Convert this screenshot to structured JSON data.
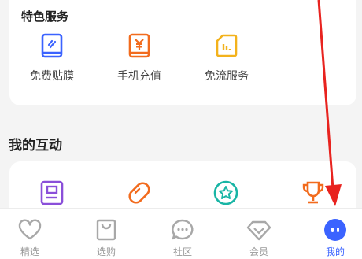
{
  "special": {
    "title": "特色服务",
    "items": [
      {
        "label": "免费贴膜",
        "icon": "phone-film-icon"
      },
      {
        "label": "手机充值",
        "icon": "yuan-recharge-icon"
      },
      {
        "label": "免流服务",
        "icon": "sim-card-icon"
      }
    ]
  },
  "interaction": {
    "title": "我的互动",
    "icons": [
      "portrait-icon",
      "capsule-icon",
      "star-badge-icon",
      "trophy-icon"
    ]
  },
  "tabbar": {
    "items": [
      {
        "label": "精选",
        "icon": "heart-icon"
      },
      {
        "label": "选购",
        "icon": "shopping-bag-icon"
      },
      {
        "label": "社区",
        "icon": "chat-bubble-icon"
      },
      {
        "label": "会员",
        "icon": "diamond-icon"
      },
      {
        "label": "我的",
        "icon": "profile-face-icon"
      }
    ],
    "active_index": 4
  },
  "colors": {
    "blue": "#3b63ff",
    "orange": "#f26b1d",
    "yellow": "#f3b21c",
    "purple": "#8a4fd9",
    "teal": "#19b5a5",
    "arrow_red": "#e8231f",
    "tab_gray": "#9a9a9a"
  }
}
